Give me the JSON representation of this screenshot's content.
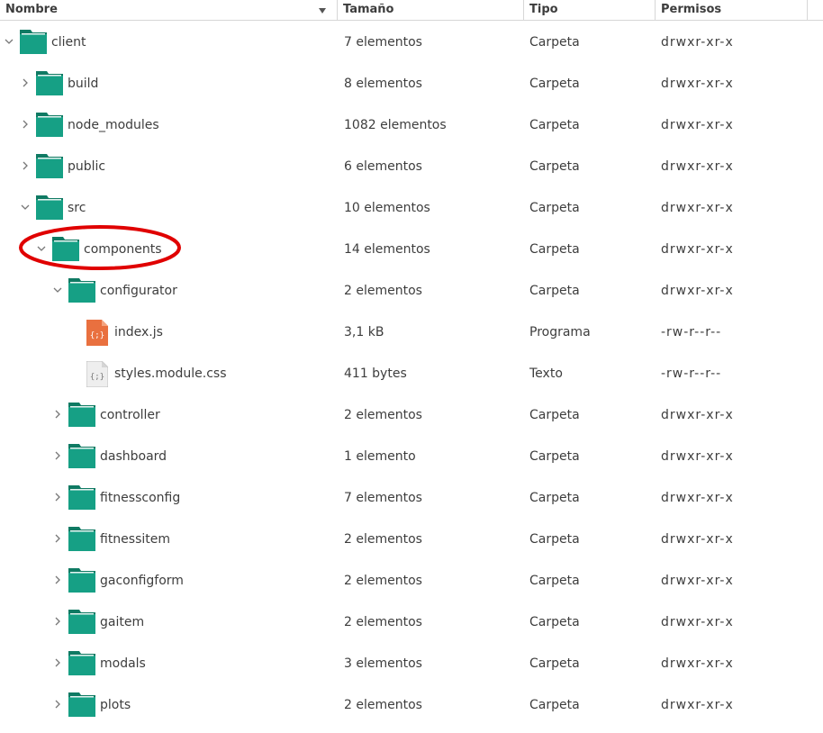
{
  "columns": {
    "name": "Nombre",
    "size": "Tamaño",
    "type": "Tipo",
    "permissions": "Permisos"
  },
  "rows": [
    {
      "name": "client",
      "size": "7 elementos",
      "type": "Carpeta",
      "perm": "drwxr-xr-x",
      "kind": "folder",
      "expanded": true
    },
    {
      "name": "build",
      "size": "8 elementos",
      "type": "Carpeta",
      "perm": "drwxr-xr-x",
      "kind": "folder",
      "expanded": false
    },
    {
      "name": "node_modules",
      "size": "1082 elementos",
      "type": "Carpeta",
      "perm": "drwxr-xr-x",
      "kind": "folder",
      "expanded": false
    },
    {
      "name": "public",
      "size": "6 elementos",
      "type": "Carpeta",
      "perm": "drwxr-xr-x",
      "kind": "folder",
      "expanded": false
    },
    {
      "name": "src",
      "size": "10 elementos",
      "type": "Carpeta",
      "perm": "drwxr-xr-x",
      "kind": "folder",
      "expanded": true
    },
    {
      "name": "components",
      "size": "14 elementos",
      "type": "Carpeta",
      "perm": "drwxr-xr-x",
      "kind": "folder",
      "expanded": true
    },
    {
      "name": "configurator",
      "size": "2 elementos",
      "type": "Carpeta",
      "perm": "drwxr-xr-x",
      "kind": "folder",
      "expanded": true
    },
    {
      "name": "index.js",
      "size": "3,1 kB",
      "type": "Programa",
      "perm": "-rw-r--r--",
      "kind": "js-file"
    },
    {
      "name": "styles.module.css",
      "size": "411 bytes",
      "type": "Texto",
      "perm": "-rw-r--r--",
      "kind": "css-file"
    },
    {
      "name": "controller",
      "size": "2 elementos",
      "type": "Carpeta",
      "perm": "drwxr-xr-x",
      "kind": "folder",
      "expanded": false
    },
    {
      "name": "dashboard",
      "size": "1 elemento",
      "type": "Carpeta",
      "perm": "drwxr-xr-x",
      "kind": "folder",
      "expanded": false
    },
    {
      "name": "fitnessconfig",
      "size": "7 elementos",
      "type": "Carpeta",
      "perm": "drwxr-xr-x",
      "kind": "folder",
      "expanded": false
    },
    {
      "name": "fitnessitem",
      "size": "2 elementos",
      "type": "Carpeta",
      "perm": "drwxr-xr-x",
      "kind": "folder",
      "expanded": false
    },
    {
      "name": "gaconfigform",
      "size": "2 elementos",
      "type": "Carpeta",
      "perm": "drwxr-xr-x",
      "kind": "folder",
      "expanded": false
    },
    {
      "name": "gaitem",
      "size": "2 elementos",
      "type": "Carpeta",
      "perm": "drwxr-xr-x",
      "kind": "folder",
      "expanded": false
    },
    {
      "name": "modals",
      "size": "3 elementos",
      "type": "Carpeta",
      "perm": "drwxr-xr-x",
      "kind": "folder",
      "expanded": false
    },
    {
      "name": "plots",
      "size": "2 elementos",
      "type": "Carpeta",
      "perm": "drwxr-xr-x",
      "kind": "folder",
      "expanded": false
    }
  ],
  "colors": {
    "folder": "#16a085",
    "folder_dark": "#0f7a63",
    "js_file": "#e9703f",
    "highlight": "#e00000"
  }
}
